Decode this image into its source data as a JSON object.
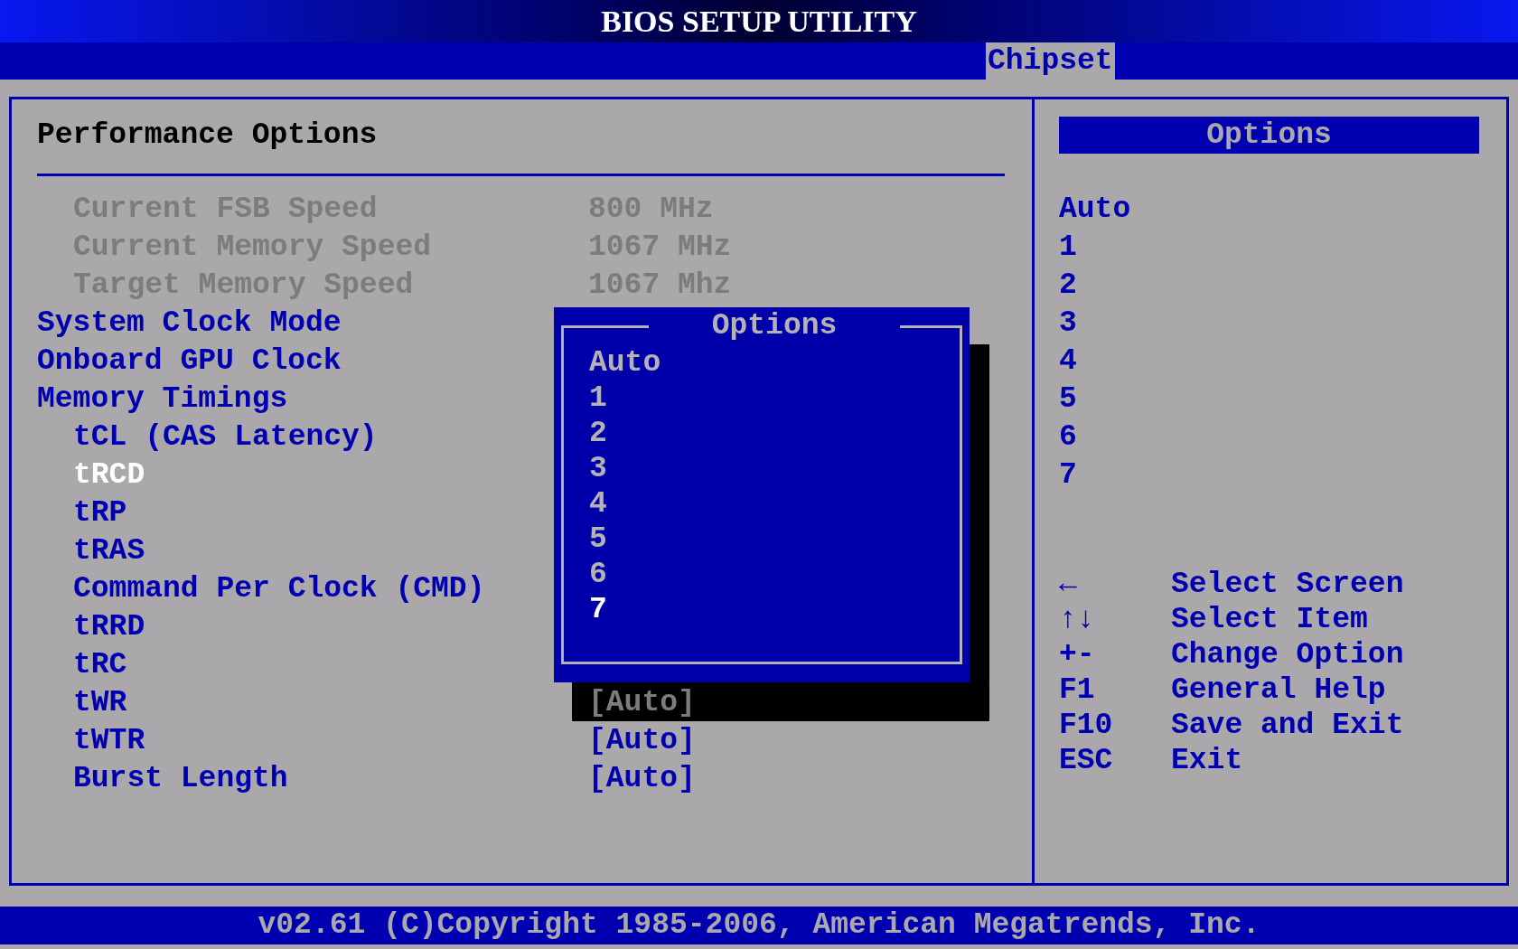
{
  "title": "BIOS SETUP UTILITY",
  "tabs": [
    {
      "label": "Chipset",
      "selected": true
    }
  ],
  "main": {
    "heading": "Performance Options",
    "rows": [
      {
        "kind": "info",
        "label": "Current FSB Speed",
        "value": "800 MHz",
        "selected": false
      },
      {
        "kind": "info",
        "label": "Current Memory Speed",
        "value": "1067 MHz",
        "selected": false
      },
      {
        "kind": "info",
        "label": "Target Memory Speed",
        "value": "1067 Mhz",
        "selected": false
      },
      {
        "kind": "item",
        "label": "System Clock Mode",
        "selected": false
      },
      {
        "kind": "item",
        "label": "Onboard GPU Clock",
        "selected": false
      },
      {
        "kind": "item",
        "label": "Memory Timings",
        "selected": false,
        "children": [
          {
            "kind": "item",
            "label": "tCL (CAS Latency)",
            "selected": false
          },
          {
            "kind": "item",
            "label": "tRCD",
            "selected": true
          },
          {
            "kind": "item",
            "label": "tRP",
            "selected": false
          },
          {
            "kind": "item",
            "label": "tRAS",
            "selected": false
          },
          {
            "kind": "item",
            "label": "Command Per Clock (CMD)",
            "selected": false
          },
          {
            "kind": "item",
            "label": "tRRD",
            "selected": false
          },
          {
            "kind": "item",
            "label": "tRC",
            "selected": false
          },
          {
            "kind": "item",
            "label": "tWR",
            "selected": false,
            "value": "[Auto]",
            "dimmed": true
          },
          {
            "kind": "item",
            "label": "tWTR",
            "selected": false,
            "value": "[Auto]",
            "dimmed": false
          },
          {
            "kind": "item",
            "label": "Burst Length",
            "selected": false,
            "value": "[Auto]",
            "dimmed": false
          }
        ]
      }
    ]
  },
  "popup": {
    "title": "Options",
    "options": [
      {
        "label": "Auto",
        "selected": false
      },
      {
        "label": "1",
        "selected": false
      },
      {
        "label": "2",
        "selected": false
      },
      {
        "label": "3",
        "selected": false
      },
      {
        "label": "4",
        "selected": false
      },
      {
        "label": "5",
        "selected": false
      },
      {
        "label": "6",
        "selected": false
      },
      {
        "label": "7",
        "selected": true
      }
    ]
  },
  "help": {
    "title": "Options",
    "options": [
      "Auto",
      "1",
      "2",
      "3",
      "4",
      "5",
      "6",
      "7"
    ],
    "keys": [
      {
        "key": "←",
        "action": "Select Screen"
      },
      {
        "key": "↑↓",
        "action": "Select Item"
      },
      {
        "key": "+-",
        "action": "Change Option"
      },
      {
        "key": "F1",
        "action": "General Help"
      },
      {
        "key": "F10",
        "action": "Save and Exit"
      },
      {
        "key": "ESC",
        "action": "Exit"
      }
    ]
  },
  "footer": "v02.61 (C)Copyright 1985-2006, American Megatrends, Inc."
}
